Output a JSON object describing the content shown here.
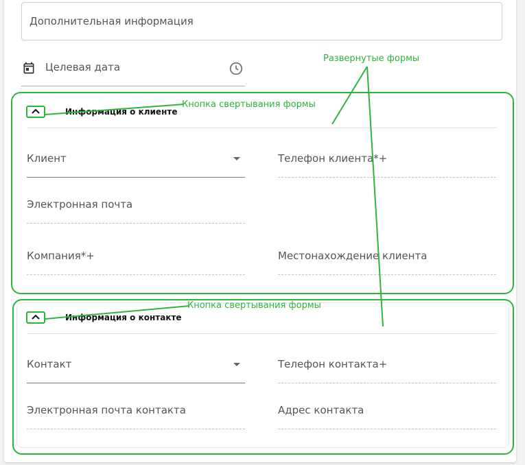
{
  "top": {
    "additional_info_label": "Дополнительная информация",
    "target_date_label": "Целевая дата"
  },
  "client_section": {
    "title": "Информация о клиенте",
    "fields": {
      "client": "Клиент",
      "client_phone": "Телефон клиента*+",
      "email": "Электронная почта",
      "company": "Компания*+",
      "client_location": "Местонахождение клиента"
    }
  },
  "contact_section": {
    "title": "Информация о контакте",
    "fields": {
      "contact": "Контакт",
      "contact_phone": "Телефон контакта+",
      "contact_email": "Электронная почта контакта",
      "contact_address": "Адрес контакта"
    }
  },
  "annotations": {
    "expanded_forms": "Развернутые формы",
    "collapse_button_1": "Кнопка свертывания формы",
    "collapse_button_2": "Кнопка свертывания формы"
  },
  "colors": {
    "annotation_green": "#2db43d"
  },
  "icons": {
    "calendar": "calendar-icon",
    "clock": "clock-icon",
    "chevron_up": "chevron-up-icon",
    "dropdown": "dropdown-arrow-icon"
  }
}
